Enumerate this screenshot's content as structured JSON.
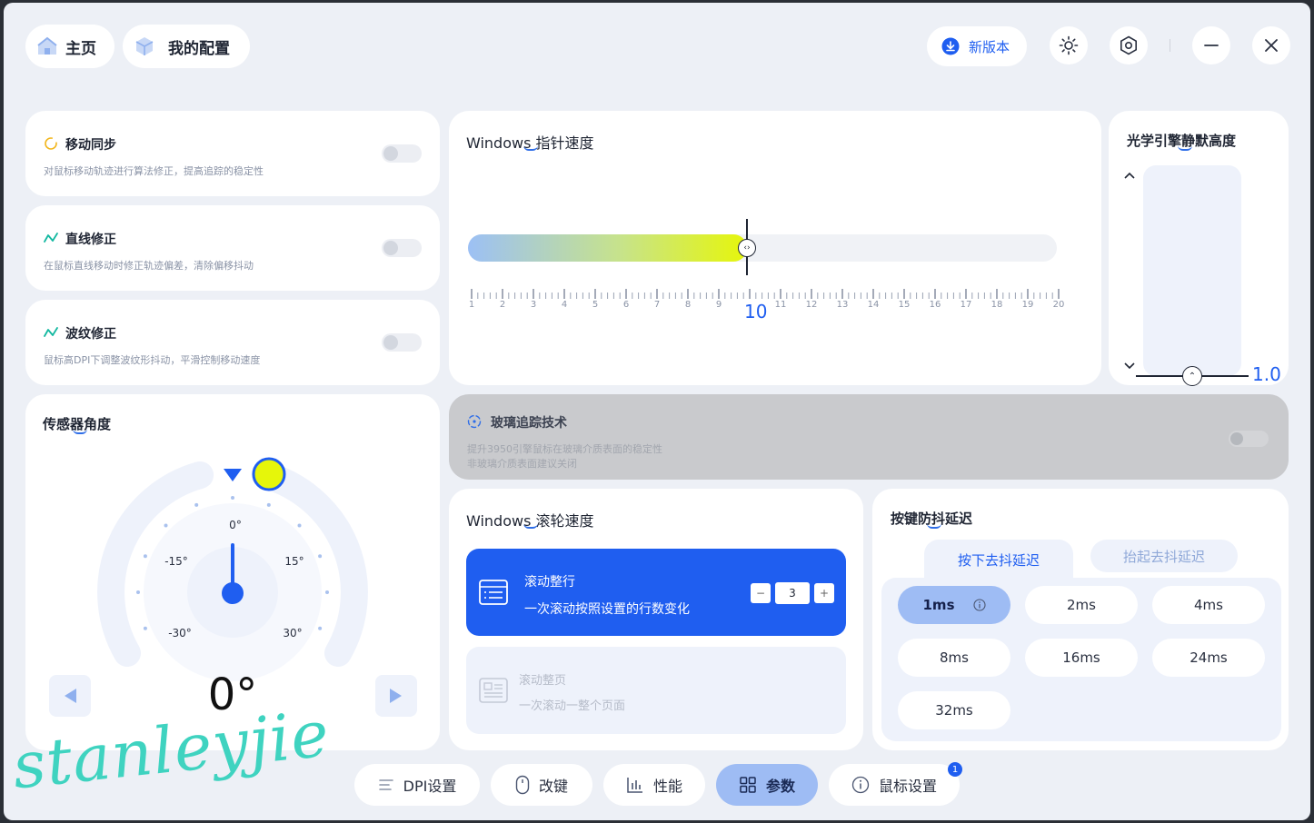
{
  "header": {
    "home_label": "主页",
    "config_label": "我的配置",
    "new_version_label": "新版本"
  },
  "toggles": [
    {
      "title": "移动同步",
      "desc": "对鼠标移动轨迹进行算法修正，提高追踪的稳定性",
      "on": false
    },
    {
      "title": "直线修正",
      "desc": "在鼠标直线移动时修正轨迹偏差，清除偏移抖动",
      "on": false
    },
    {
      "title": "波纹修正",
      "desc": "鼠标高DPI下调整波纹形抖动，平滑控制移动速度",
      "on": false
    }
  ],
  "pointer_speed": {
    "title": "Windows 指针速度",
    "value": "10",
    "min": 1,
    "max": 20,
    "ticks": [
      "1",
      "2",
      "3",
      "4",
      "5",
      "6",
      "7",
      "8",
      "9",
      "11",
      "12",
      "13",
      "14",
      "15",
      "16",
      "17",
      "18",
      "19",
      "20"
    ]
  },
  "lod": {
    "title": "光学引擎静默高度",
    "value": "1.0"
  },
  "sensor_angle": {
    "title": "传感器角度",
    "value": "0°",
    "labels": {
      "a0": "0°",
      "am15": "-15°",
      "a15": "15°",
      "am30": "-30°",
      "a30": "30°"
    }
  },
  "glass_tracking": {
    "title": "玻璃追踪技术",
    "desc1": "提升3950引擎鼠标在玻璃介质表面的稳定性",
    "desc2": "非玻璃介质表面建议关闭",
    "enabled": false
  },
  "scroll_speed": {
    "title": "Windows 滚轮速度",
    "option1_title": "滚动整行",
    "option1_desc": "一次滚动按照设置的行数变化",
    "option1_minus": "−",
    "option1_value": "3",
    "option1_plus": "+",
    "option2_title": "滚动整页",
    "option2_desc": "一次滚动一整个页面"
  },
  "debounce": {
    "title": "按键防抖延迟",
    "tab_press": "按下去抖延迟",
    "tab_release": "抬起去抖延迟",
    "options": [
      "1ms",
      "2ms",
      "4ms",
      "8ms",
      "16ms",
      "24ms",
      "32ms"
    ],
    "selected": "1ms"
  },
  "bottom_tabs": [
    {
      "label": "DPI设置"
    },
    {
      "label": "改键"
    },
    {
      "label": "性能"
    },
    {
      "label": "参数"
    },
    {
      "label": "鼠标设置"
    }
  ],
  "notification_count": "1",
  "watermark": "stanleyjie",
  "colors": {
    "accent": "#1f5ef0",
    "active_tab": "#9ebcf4",
    "slider_end": "#e6f60a"
  }
}
